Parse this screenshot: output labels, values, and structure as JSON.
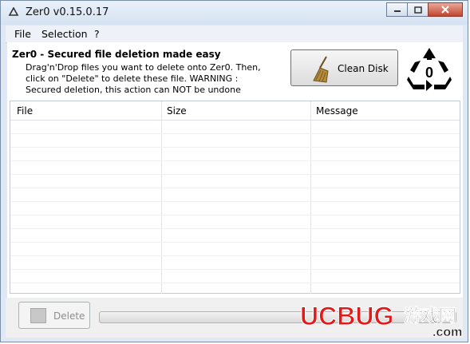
{
  "window": {
    "title": "Zer0 v0.15.0.17"
  },
  "menu": {
    "items": [
      "File",
      "Selection",
      "?"
    ]
  },
  "header": {
    "title": "Zer0 - Secured file deletion made easy",
    "description": "Drag'n'Drop files you want to delete onto Zer0. Then, click on \"Delete\" to delete these file. WARNING : Secured deletion, this action can NOT be undone",
    "clean_disk_label": "Clean Disk",
    "recycle_number": "0"
  },
  "table": {
    "columns": [
      "File",
      "Size",
      "Message"
    ]
  },
  "footer": {
    "delete_label": "Delete",
    "progress": 0
  },
  "watermark": {
    "brand": "UCBUG",
    "cn": "游戏网",
    "domain": ".com"
  },
  "colors": {
    "titlebar": "#dbe6f3",
    "close_button": "#c8452f",
    "watermark_red": "#e21a1a",
    "watermark_blue": "#1b5ea8"
  }
}
